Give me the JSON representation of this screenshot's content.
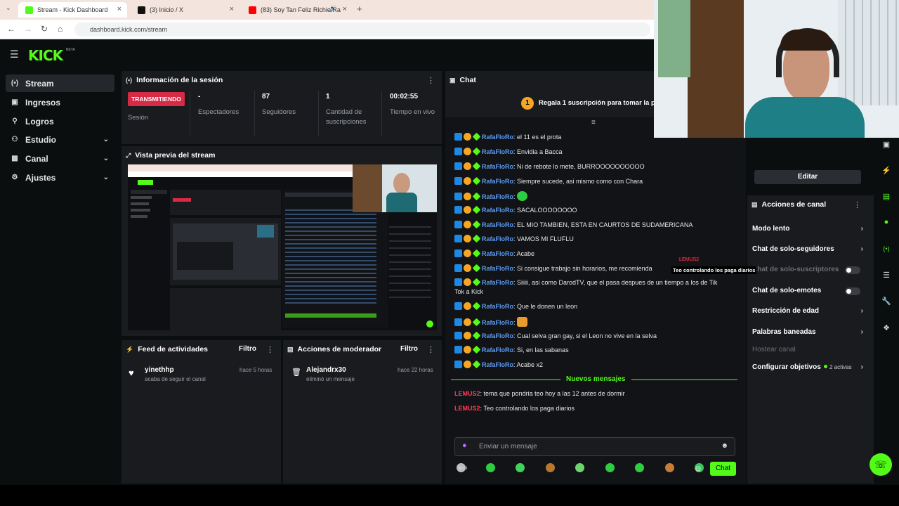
{
  "browser": {
    "tabs": [
      {
        "title": "Stream - Kick Dashboard",
        "active": true,
        "favicon_color": "#53fc18"
      },
      {
        "title": "(3) Inicio / X",
        "active": false,
        "favicon_color": "#111111"
      },
      {
        "title": "(83) Soy Tan Feliz Richie Ra",
        "active": false,
        "favicon_color": "#ff0000"
      }
    ],
    "new_tab": "+",
    "url": "dashboard.kick.com/stream"
  },
  "app": {
    "logo": "KICK",
    "logo_badge": "BETA",
    "accent": "#53fc18"
  },
  "sidebar": {
    "items": [
      {
        "label": "Stream",
        "icon": "broadcast-icon",
        "active": true,
        "expandable": false
      },
      {
        "label": "Ingresos",
        "icon": "money-icon",
        "active": false,
        "expandable": false
      },
      {
        "label": "Logros",
        "icon": "trophy-icon",
        "active": false,
        "expandable": false
      },
      {
        "label": "Estudio",
        "icon": "studio-icon",
        "active": false,
        "expandable": true
      },
      {
        "label": "Canal",
        "icon": "channel-icon",
        "active": false,
        "expandable": true
      },
      {
        "label": "Ajustes",
        "icon": "gear-icon",
        "active": false,
        "expandable": true
      }
    ]
  },
  "session": {
    "title": "Información de la sesión",
    "status": "TRANSMITIENDO",
    "status_label": "Sesión",
    "stats": [
      {
        "value": "-",
        "label": "Espectadores"
      },
      {
        "value": "87",
        "label": "Seguidores"
      },
      {
        "value": "1",
        "label": "Cantidad de suscripciones"
      },
      {
        "value": "00:02:55",
        "label": "Tiempo en vivo"
      }
    ]
  },
  "preview": {
    "title": "Vista previa del stream"
  },
  "activity": {
    "title": "Feed de actividades",
    "filter": "Filtro",
    "items": [
      {
        "user": "yinethhp",
        "action": "acaba de seguir el canal",
        "time": "hace 5 horas"
      }
    ]
  },
  "mod_actions": {
    "title": "Acciones de moderador",
    "filter": "Filtro",
    "items": [
      {
        "user": "Alejandrx30",
        "action": "eliminó un mensaje",
        "time": "hace 22 horas"
      }
    ]
  },
  "chat": {
    "title": "Chat",
    "pinned": "Regala 1 suscripción para tomar la posi",
    "pinned_count": "1",
    "messages": [
      {
        "user": "RafaFloRo",
        "text": "el 11 es el prota"
      },
      {
        "user": "RafaFloRo",
        "text": "Envidia a Bacca"
      },
      {
        "user": "RafaFloRo",
        "text": "Ni de rebote lo mete, BURROOOOOOOOOO"
      },
      {
        "user": "RafaFloRo",
        "text": "Siempre sucede, asi mismo como con Chara"
      },
      {
        "user": "RafaFloRo",
        "text": "",
        "emote": true
      },
      {
        "user": "RafaFloRo",
        "text": "SACALOOOOOOOO"
      },
      {
        "user": "RafaFloRo",
        "text": "EL MIO TAMBIEN, ESTA EN CAURTOS DE SUDAMERICANA"
      },
      {
        "user": "RafaFloRo",
        "text": "VAMOS MI FLUFLU"
      },
      {
        "user": "RafaFloRo",
        "text": "Acabe"
      },
      {
        "user": "RafaFloRo",
        "text": "Si consigue trabajo sin horarios, me recomienda"
      },
      {
        "user": "RafaFloRo",
        "text": "Siiiii, asi como DarodTV, que el pasa despues de un tiempo a los de Tik",
        "text2": "Tok a Kick"
      },
      {
        "user": "RafaFloRo",
        "text": "Que le donen un leon"
      },
      {
        "user": "RafaFloRo",
        "text": "",
        "emote": true
      },
      {
        "user": "RafaFloRo",
        "text": "Cual selva gran gay, si el Leon no vive en la selva"
      },
      {
        "user": "RafaFloRo",
        "text": "Si, en las sabanas"
      },
      {
        "user": "RafaFloRo",
        "text": "Acabe x2"
      }
    ],
    "new_messages_label": "Nuevos mensajes",
    "new_messages": [
      {
        "user": "LEMUS2",
        "text": "tema que pondria teo hoy a las 12 antes de dormir"
      },
      {
        "user": "LEMUS2",
        "text": "Teo controlando los paga diarios"
      }
    ],
    "hover_tag": "LEMUS2",
    "hover_text": "Teo controlando los paga diarios",
    "input_placeholder": "Enviar un mensaje",
    "send_label": "Chat"
  },
  "channel_actions": {
    "edit_label": "Editar",
    "title": "Acciones de canal",
    "rows": [
      {
        "label": "Modo lento",
        "kind": "chevron"
      },
      {
        "label": "Chat de solo-seguidores",
        "kind": "chevron"
      },
      {
        "label": "Chat de solo-suscriptores",
        "kind": "toggle",
        "dim": true
      },
      {
        "label": "Chat de solo-emotes",
        "kind": "toggle"
      },
      {
        "label": "Restricción de edad",
        "kind": "chevron"
      },
      {
        "label": "Palabras baneadas",
        "kind": "chevron"
      },
      {
        "label": "Hostear canal",
        "kind": "none",
        "dim": true
      },
      {
        "label": "Configurar objetivos",
        "kind": "chevron",
        "extra": "2 activas"
      }
    ]
  },
  "right_rail_icons": [
    "expand-icon",
    "bolt-icon",
    "document-icon",
    "chat-bubble-icon",
    "broadcast-icon",
    "layers-icon",
    "wrench-icon",
    "grid-icon"
  ]
}
